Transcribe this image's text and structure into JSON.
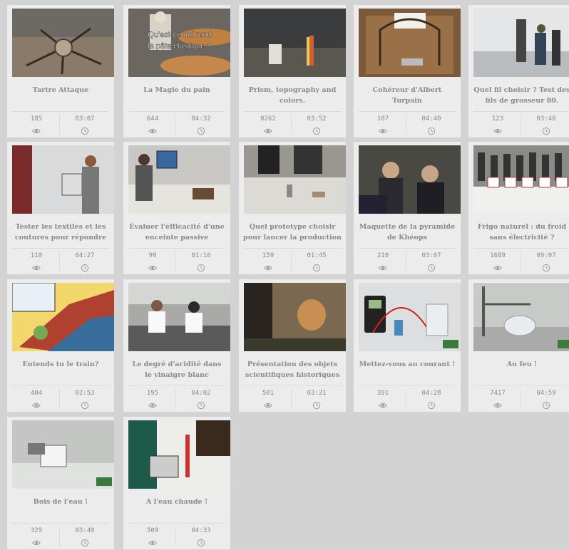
{
  "cards": [
    {
      "title": "Tartre Attaque",
      "views": "185",
      "duration": "03:07",
      "overlay": ""
    },
    {
      "title": "La Magie du pain",
      "views": "644",
      "duration": "04:32",
      "overlay": "Qu'est-ce qui rend la pâte élastique ?"
    },
    {
      "title": "Prism, topography and colors.",
      "views": "8262",
      "duration": "03:52",
      "overlay": ""
    },
    {
      "title": "Cohéreur d'Albert Turpain",
      "views": "107",
      "duration": "04:40",
      "overlay": ""
    },
    {
      "title": "Quel fil choisir ? Test des fils de grosseur 80.",
      "views": "123",
      "duration": "03:48",
      "overlay": ""
    },
    {
      "title": "Tester les textiles et les coutures pour répondre au",
      "views": "110",
      "duration": "04:27",
      "overlay": ""
    },
    {
      "title": "Évaluer l'efficacité d'une enceinte passive",
      "views": "99",
      "duration": "01:10",
      "overlay": ""
    },
    {
      "title": "Quel prototype choisir pour lancer la production",
      "views": "159",
      "duration": "01:45",
      "overlay": ""
    },
    {
      "title": "Maquette de la pyramide de Khéops",
      "views": "210",
      "duration": "03:07",
      "overlay": ""
    },
    {
      "title": "Frigo naturel : du froid sans électricité ?",
      "views": "1689",
      "duration": "09:07",
      "overlay": ""
    },
    {
      "title": "Entends tu le train?",
      "views": "404",
      "duration": "02:53",
      "overlay": ""
    },
    {
      "title": "Le degré d'acidité dans le vinaigre blanc",
      "views": "195",
      "duration": "04:02",
      "overlay": ""
    },
    {
      "title": "Présentation des objets scientifiques historiques",
      "views": "501",
      "duration": "03:21",
      "overlay": ""
    },
    {
      "title": "Mettez-vous au courant !",
      "views": "391",
      "duration": "04:28",
      "overlay": ""
    },
    {
      "title": "Au feu !",
      "views": "7417",
      "duration": "04:59",
      "overlay": ""
    },
    {
      "title": "Bois de l'eau !",
      "views": "329",
      "duration": "03:49",
      "overlay": ""
    },
    {
      "title": "A l'eau chaude !",
      "views": "509",
      "duration": "04:33",
      "overlay": ""
    }
  ],
  "icons": {
    "views": "eye-icon",
    "duration": "clock-icon"
  },
  "colors": {
    "page_bg": "#d3d3d3",
    "card_bg": "#ececec",
    "text": "#8a8a8a"
  }
}
